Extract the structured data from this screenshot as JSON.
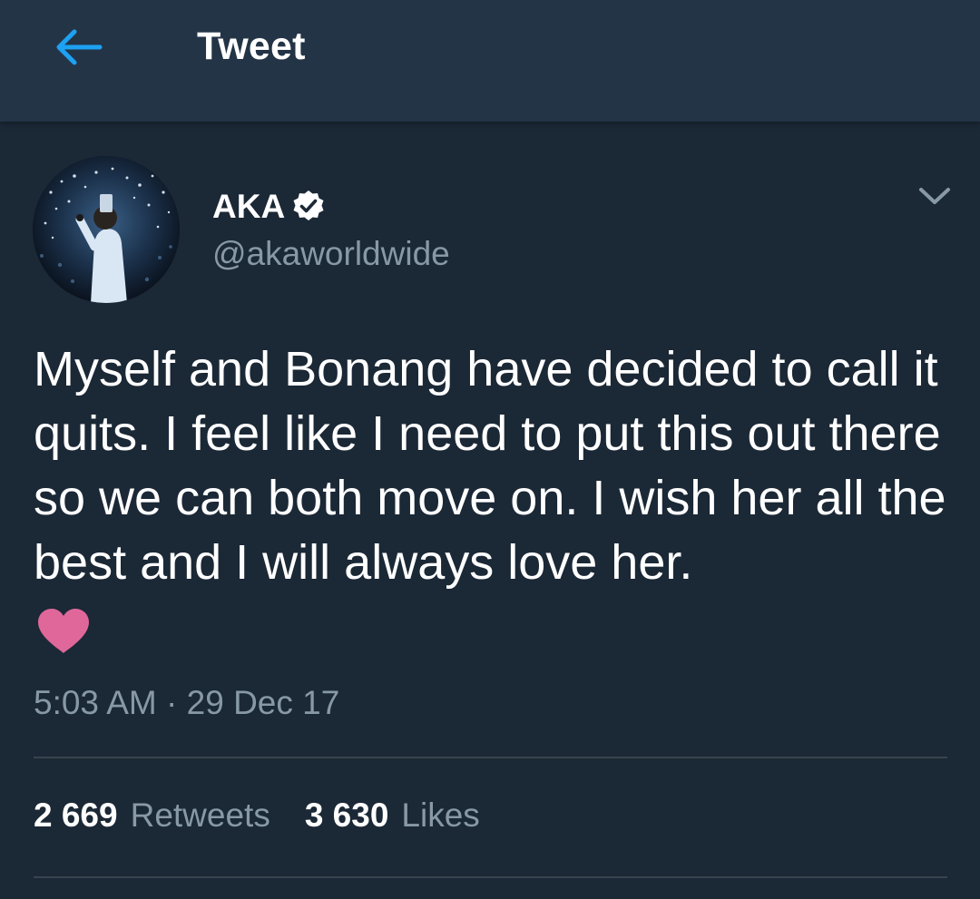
{
  "header": {
    "title": "Tweet",
    "back_icon": "arrow-left-icon",
    "accent_color": "#1da1f2"
  },
  "tweet": {
    "author": {
      "name": "AKA",
      "handle": "@akaworldwide",
      "verified": true,
      "avatar_icon": "profile-photo"
    },
    "menu_icon": "chevron-down-icon",
    "text": "Myself and Bonang have decided to call it quits. I feel like I need to put this out there so we can both move on. I wish her all the best and I will always love her.",
    "emoji": "pink-heart-emoji",
    "timestamp": "5:03 AM · 29 Dec 17",
    "stats": {
      "retweets_count": "2 669",
      "retweets_label": "Retweets",
      "likes_count": "3 630",
      "likes_label": "Likes"
    }
  },
  "colors": {
    "background": "#1b2836",
    "header_background": "#243447",
    "secondary_text": "#8899a6",
    "divider": "#38444d",
    "heart": "#e0679a"
  }
}
